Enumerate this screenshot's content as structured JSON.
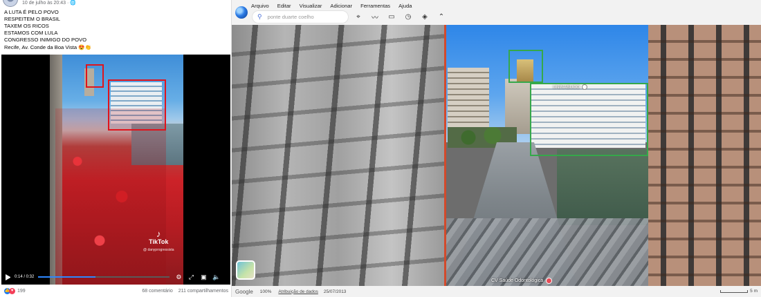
{
  "post": {
    "date": "10 de julho às 20:43 · ",
    "lines": [
      "A LUTA É PELO POVO",
      "RESPEITEM O BRASIL",
      "TAXEM OS RICOS",
      "ESTAMOS COM LULA",
      "CONGRESSO INIMIGO DO POVO"
    ],
    "location": "Recife, Av. Conde da Boa Vista",
    "location_emoji": "😍👏",
    "video": {
      "time": "0:14 / 0:32",
      "progress": 0.4375,
      "watermark": "TikTok",
      "watermark_handle": "@ danyprogressista"
    },
    "reactions": {
      "count": "199",
      "types": [
        "like",
        "love"
      ]
    },
    "comments": "68 comentário",
    "shares": "211 compartilhamentos"
  },
  "earth": {
    "menu": [
      "Arquivo",
      "Editar",
      "Visualizar",
      "Adicionar",
      "Ferramentas",
      "Ajuda"
    ],
    "search": {
      "placeholder": "ponte duarte coelho"
    },
    "tools": [
      "placemark-icon",
      "path-icon",
      "ruler-icon",
      "history-icon",
      "layers-icon",
      "collapse-icon"
    ],
    "places": {
      "unin": "UNINABUCO",
      "cv": "CV Saúde Odontológica"
    },
    "status": {
      "brand": "Google",
      "zoom": "100%",
      "attribution": "Atribuição de dados",
      "date": "25/07/2013",
      "scale": "5 m"
    },
    "colors": {
      "annotation_red": "#e1131b",
      "annotation_green": "#35a84a",
      "facebook_blue": "#1877f2"
    }
  }
}
